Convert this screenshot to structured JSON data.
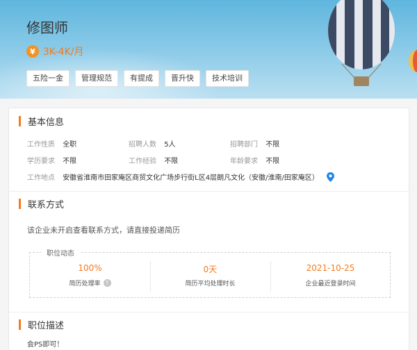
{
  "header": {
    "job_title": "修图师",
    "salary": "3K-4K/月",
    "currency_glyph": "¥",
    "tags": [
      "五险一金",
      "管理规范",
      "有提成",
      "晋升快",
      "技术培训"
    ]
  },
  "basic_info": {
    "title": "基本信息",
    "row1": [
      {
        "k": "工作性质",
        "v": "全职"
      },
      {
        "k": "招聘人数",
        "v": "5人"
      },
      {
        "k": "招聘部门",
        "v": "不限"
      }
    ],
    "row2": [
      {
        "k": "学历要求",
        "v": "不限"
      },
      {
        "k": "工作经验",
        "v": "不限"
      },
      {
        "k": "年龄要求",
        "v": "不限"
      }
    ],
    "location": {
      "k": "工作地点",
      "v": "安徽省淮南市田家庵区商贸文化广场步行街L区4层朗凡文化（安徽/淮南/田家庵区）"
    }
  },
  "contact": {
    "title": "联系方式",
    "note": "该企业未开启查看联系方式，请直接投递简历"
  },
  "dynamics": {
    "title": "职位动态",
    "stats": [
      {
        "value": "100%",
        "caption": "简历处理率"
      },
      {
        "value": "0天",
        "caption": "简历平均处理时长"
      },
      {
        "value": "2021-10-25",
        "caption": "企业最近登录时间"
      }
    ],
    "help_glyph": "?"
  },
  "description": {
    "title": "职位描述",
    "text": "会PS即可！"
  },
  "colors": {
    "accent": "#f47a1f",
    "sky": "#5fb6de",
    "pin": "#1e88e5"
  },
  "icons": {
    "currency": "yen-icon",
    "location": "location-pin-icon",
    "help": "question-icon"
  }
}
